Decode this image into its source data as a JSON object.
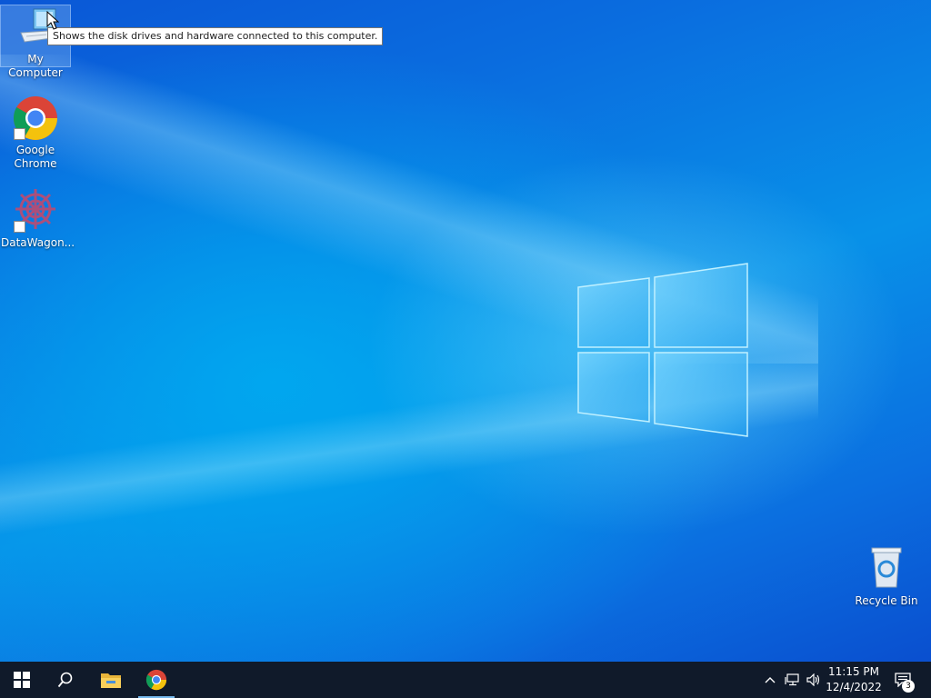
{
  "desktop": {
    "icons": [
      {
        "label": "My Computer",
        "icon": "computer-icon",
        "selected": true
      },
      {
        "label": "Google\nChrome",
        "icon": "chrome-icon",
        "shortcut": true
      },
      {
        "label": "DataWagon...",
        "icon": "datawagon-icon",
        "shortcut": true
      },
      {
        "label": "Recycle Bin",
        "icon": "recycle-bin-icon"
      }
    ],
    "tooltip": "Shows the disk drives and hardware connected to this computer."
  },
  "taskbar": {
    "start": "windows-start-icon",
    "search": "search-icon",
    "pinned": [
      {
        "name": "file-explorer-icon"
      },
      {
        "name": "chrome-icon",
        "active": true
      }
    ],
    "tray": {
      "chevron": "chevron-up-icon",
      "network": "network-icon",
      "volume": "volume-icon",
      "time": "11:15 PM",
      "date": "12/4/2022",
      "notifications_count": "3"
    }
  },
  "colors": {
    "taskbar": "#101a2a",
    "accent": "#76b9ed"
  }
}
